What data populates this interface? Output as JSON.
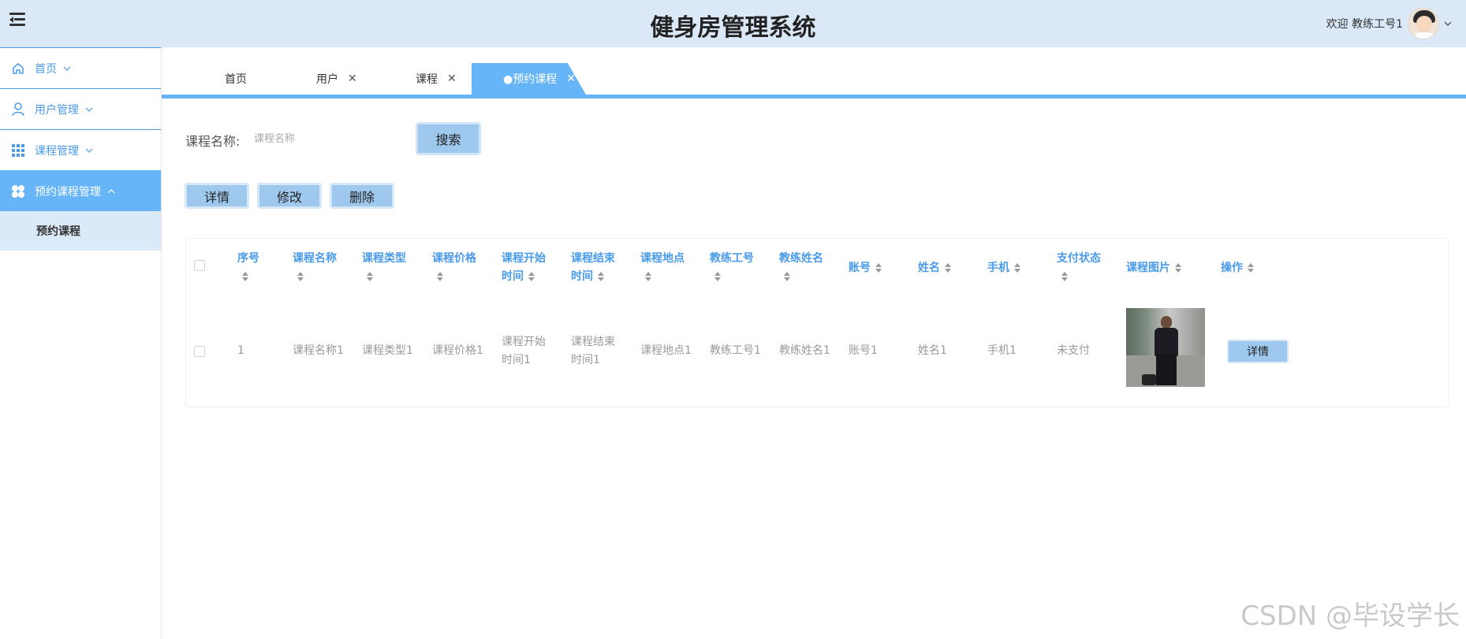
{
  "header": {
    "title": "健身房管理系统",
    "welcome": "欢迎 教练工号1"
  },
  "sidebar": {
    "items": [
      {
        "label": "首页",
        "icon": "home-icon"
      },
      {
        "label": "用户管理",
        "icon": "user-icon"
      },
      {
        "label": "课程管理",
        "icon": "grid-icon"
      },
      {
        "label": "预约课程管理",
        "icon": "clover-icon"
      }
    ],
    "sub_item": "预约课程"
  },
  "tabs": [
    {
      "label": "首页"
    },
    {
      "label": "用户"
    },
    {
      "label": "课程"
    },
    {
      "label": "●预约课程"
    }
  ],
  "search": {
    "label": "课程名称:",
    "placeholder": "课程名称",
    "button": "搜索"
  },
  "actions": {
    "detail": "详情",
    "edit": "修改",
    "delete": "删除"
  },
  "table": {
    "headers": {
      "index": "序号",
      "course_name": "课程名称",
      "course_type": "课程类型",
      "course_price": "课程价格",
      "start_time_1": "课程开始",
      "start_time_2": "时间",
      "end_time_1": "课程结束",
      "end_time_2": "时间",
      "location": "课程地点",
      "coach_id": "教练工号",
      "coach_name": "教练姓名",
      "account": "账号",
      "name": "姓名",
      "phone": "手机",
      "pay_status": "支付状态",
      "course_image": "课程图片",
      "operation": "操作"
    },
    "row": {
      "index": "1",
      "course_name": "课程名称1",
      "course_type": "课程类型1",
      "course_price": "课程价格1",
      "start_time_1": "课程开始",
      "start_time_2": "时间1",
      "end_time_1": "课程结束",
      "end_time_2": "时间1",
      "location": "课程地点1",
      "coach_id": "教练工号1",
      "coach_name": "教练姓名1",
      "account": "账号1",
      "name": "姓名1",
      "phone": "手机1",
      "pay_status": "未支付",
      "detail_button": "详情"
    }
  },
  "watermark": "CSDN @毕设学长",
  "colors": {
    "header_bg": "#dbe8f7",
    "accent": "#66b5f8",
    "link_blue": "#4a9be8",
    "button_bg": "#9ec8ee"
  }
}
